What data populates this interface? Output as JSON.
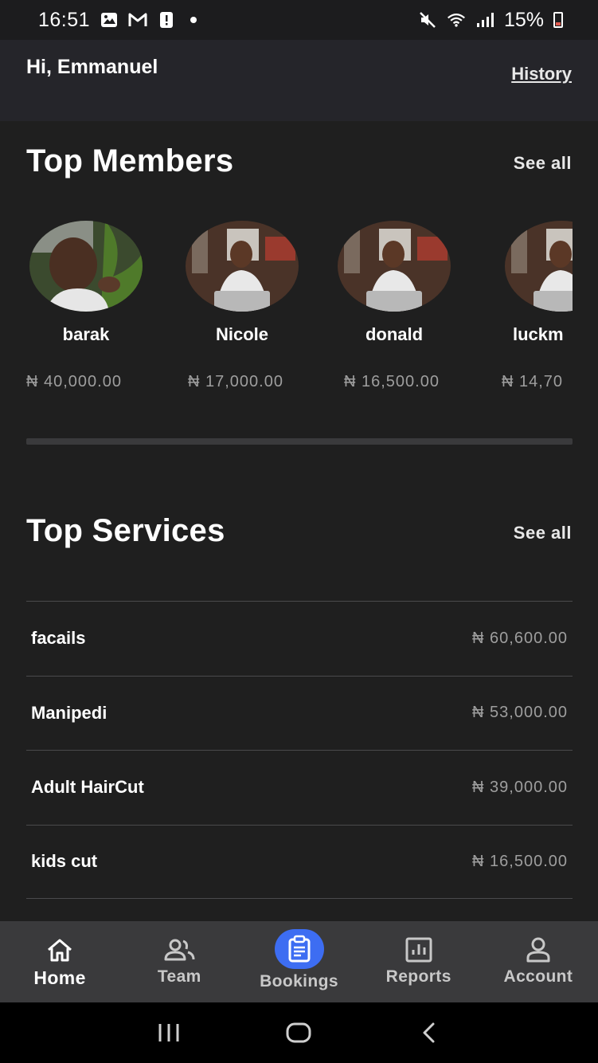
{
  "status_bar": {
    "time": "16:51",
    "battery": "15%",
    "left_icons": [
      "gallery-icon",
      "gmail-icon",
      "alert-icon",
      "dot-icon"
    ],
    "right_icons": [
      "mute-icon",
      "wifi-icon",
      "signal-icon",
      "battery-icon"
    ]
  },
  "header": {
    "greeting": "Hi, Emmanuel",
    "history_label": "History"
  },
  "top_members": {
    "title": "Top Members",
    "see_all": "See all",
    "members": [
      {
        "name": "barak",
        "amount": "₦ 40,000.00"
      },
      {
        "name": "Nicole",
        "amount": "₦ 17,000.00"
      },
      {
        "name": "donald",
        "amount": "₦ 16,500.00"
      },
      {
        "name": "luckm",
        "amount": "₦ 14,70"
      }
    ]
  },
  "top_services": {
    "title": "Top Services",
    "see_all": "See all",
    "services": [
      {
        "name": "facails",
        "amount": "₦ 60,600.00"
      },
      {
        "name": "Manipedi",
        "amount": "₦ 53,000.00"
      },
      {
        "name": "Adult HairCut",
        "amount": "₦ 39,000.00"
      },
      {
        "name": "kids cut",
        "amount": "₦ 16,500.00"
      }
    ]
  },
  "bottom_nav": {
    "items": [
      {
        "label": "Home",
        "icon": "home-icon",
        "active": true
      },
      {
        "label": "Team",
        "icon": "team-icon"
      },
      {
        "label": "Bookings",
        "icon": "bookings-icon"
      },
      {
        "label": "Reports",
        "icon": "reports-icon"
      },
      {
        "label": "Account",
        "icon": "account-icon"
      }
    ]
  },
  "colors": {
    "background": "#1f1f1f",
    "header_bg": "#25252a",
    "nav_bg": "#3a3a3c",
    "accent": "#3d6df2",
    "muted_text": "#9e9e9e"
  }
}
